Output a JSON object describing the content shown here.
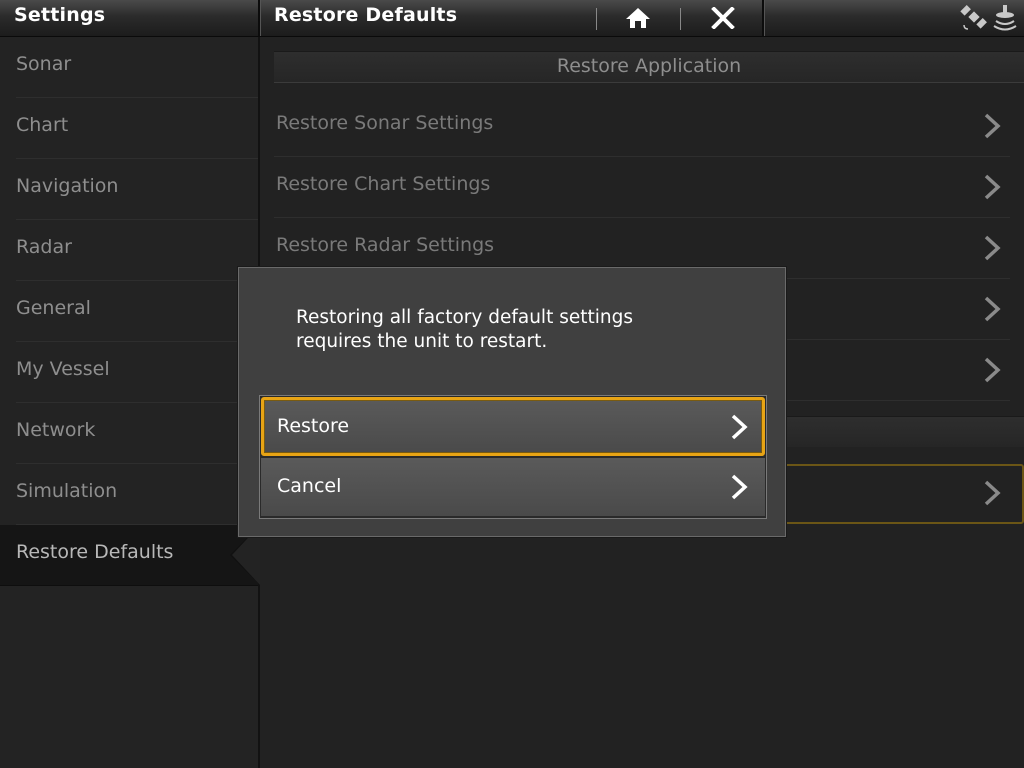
{
  "topbar": {
    "left_title": "Settings",
    "right_title": "Restore Defaults",
    "home_icon": "home-icon",
    "close_icon": "close-icon",
    "status_icons": [
      "gps-satellite-icon",
      "sonar-transducer-icon"
    ]
  },
  "sidebar": {
    "items": [
      {
        "label": "Sonar"
      },
      {
        "label": "Chart"
      },
      {
        "label": "Navigation"
      },
      {
        "label": "Radar"
      },
      {
        "label": "General"
      },
      {
        "label": "My Vessel"
      },
      {
        "label": "Network"
      },
      {
        "label": "Simulation"
      },
      {
        "label": "Restore Defaults",
        "active": true
      }
    ]
  },
  "main": {
    "section_title": "Restore Application",
    "rows": [
      {
        "label": "Restore Sonar Settings"
      },
      {
        "label": "Restore Chart Settings"
      },
      {
        "label": "Restore Radar Settings"
      }
    ]
  },
  "dialog": {
    "message_line1": "Restoring all factory default settings",
    "message_line2": "requires the unit to restart.",
    "restore_label": "Restore",
    "cancel_label": "Cancel"
  },
  "colors": {
    "accent": "#e8a415",
    "background": "#222222",
    "dialog_bg": "#404040"
  }
}
